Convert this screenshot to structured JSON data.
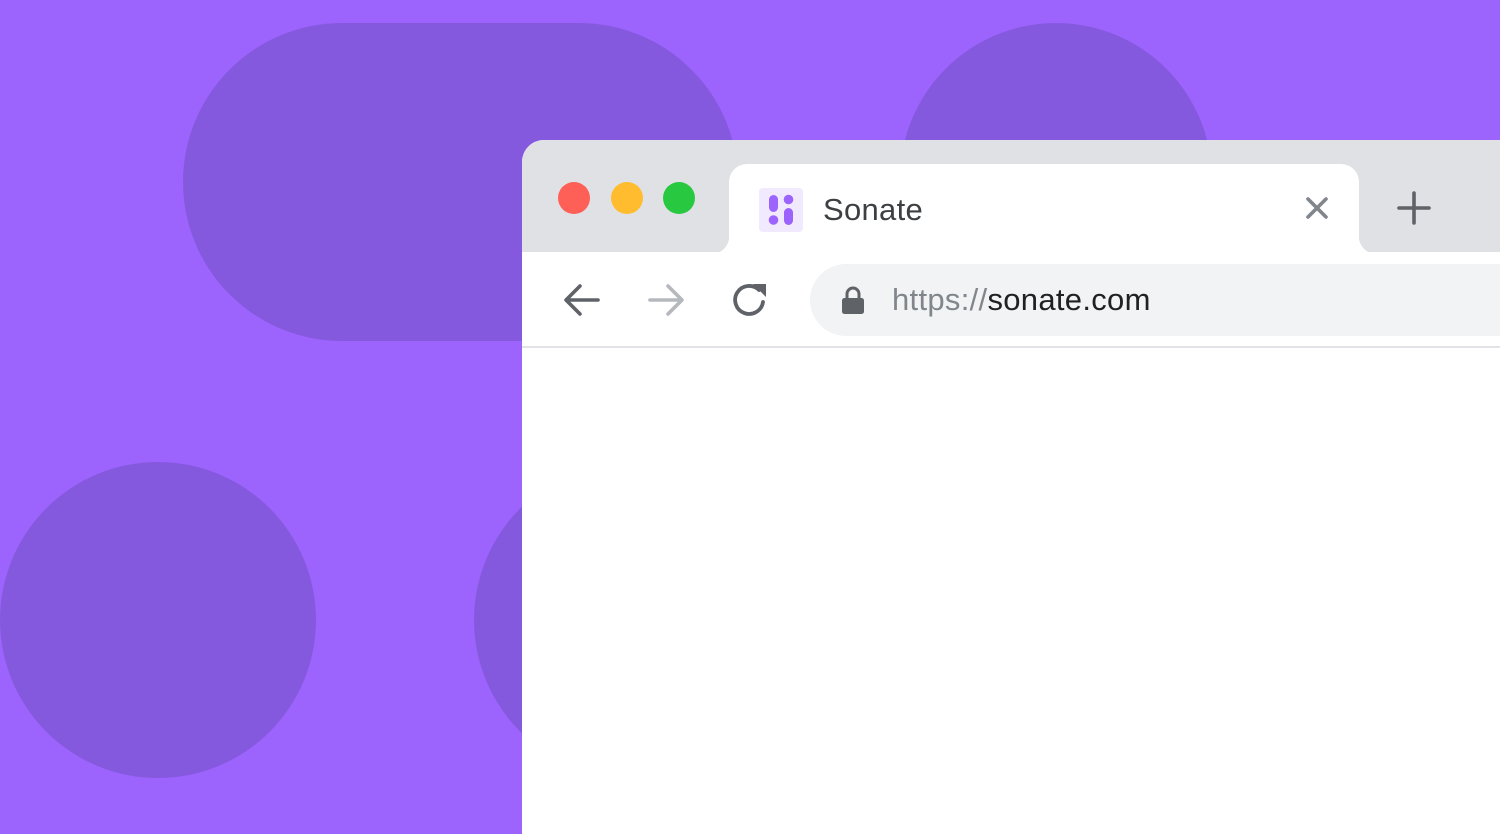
{
  "colors": {
    "background": "#9d63fd",
    "background_shapes": "#8559de",
    "tabstrip": "#dfe1e5",
    "traffic_red": "#fe5f57",
    "traffic_yellow": "#febc2e",
    "traffic_green": "#28c840",
    "favicon_accent": "#9d63fd"
  },
  "window": {
    "traffic_lights": [
      "close",
      "minimize",
      "zoom"
    ]
  },
  "tab": {
    "title": "Sonate",
    "favicon": "sonate-logo-icon",
    "close_icon": "close-icon"
  },
  "new_tab_icon": "plus-icon",
  "toolbar": {
    "back_icon": "arrow-left-icon",
    "forward_icon": "arrow-right-icon",
    "reload_icon": "reload-icon"
  },
  "address_bar": {
    "lock_icon": "lock-icon",
    "scheme": "https://",
    "host": "sonate.com"
  }
}
